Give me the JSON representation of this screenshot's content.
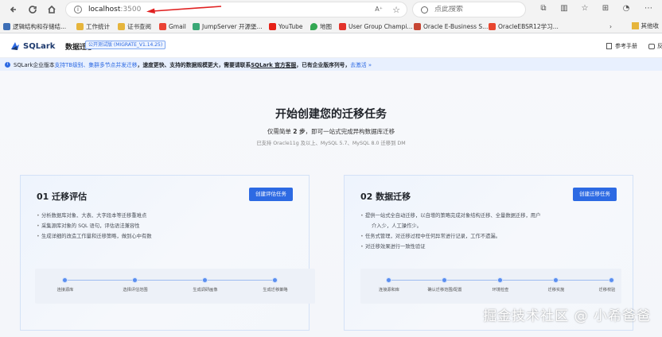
{
  "browser": {
    "url_host": "localhost",
    "url_port": ":3500",
    "search_placeholder": "点此搜索",
    "reader_label": "A⁺",
    "icons": [
      "back-icon",
      "refresh-icon",
      "home-icon",
      "info-icon",
      "star-icon",
      "split-icon",
      "favorites-icon",
      "collections-icon",
      "more-icon"
    ]
  },
  "bookmarks": {
    "items": [
      {
        "label": "逻辑结构和存储结...",
        "color": "#3d6fb6"
      },
      {
        "label": "工作统计",
        "color": "#e6b53c"
      },
      {
        "label": "证书查阅",
        "color": "#e6b53c"
      },
      {
        "label": "Gmail",
        "color": "#ea4335"
      },
      {
        "label": "JumpServer 开源堡...",
        "color": "#3aa876"
      },
      {
        "label": "YouTube",
        "color": "#e62117"
      },
      {
        "label": "地图",
        "color": "#34a853"
      },
      {
        "label": "User Group Champi...",
        "color": "#e3322b"
      },
      {
        "label": "Oracle E-Business S...",
        "color": "#c74634"
      },
      {
        "label": "OracleEBSR12学习...",
        "color": "#e8462f"
      }
    ],
    "more_label": "其他收"
  },
  "app": {
    "logo_text": "SQLark",
    "title": "数据迁移",
    "beta_tag": "公开测试版 (MIGRATE_V1.14.25)",
    "manual": "参考手册",
    "feedback": "反"
  },
  "notice": {
    "prefix": "SQLark企业版本",
    "link1": "支持TB级别、集群多节点并发迁移",
    "mid": "，速度更快、支持的数据规模更大，需要请联系",
    "link2": "SQLark 官方客服",
    "suffix": "，已有企业版序列号，",
    "activate": "去激活 »"
  },
  "hero": {
    "title": "开始创建您的迁移任务",
    "sub_before": "仅需简单",
    "sub_step": "2 步",
    "sub_after": "，即可一站式完成异构数据库迁移",
    "note": "已支持 Oracle11g 及以上、MySQL 5.7、MySQL 8.0 迁移到 DM"
  },
  "cards": [
    {
      "title": "01 迁移评估",
      "button": "创建评估任务",
      "bullets": [
        {
          "text": "分析数据库对象、大表、大字段本等迁移重难点",
          "cont": false
        },
        {
          "text": "采集源库对象的 SQL 语句，评估语法兼容性",
          "cont": false
        },
        {
          "text": "生成详细的改造工作量和迁移策略，做到心中有数",
          "cont": false
        }
      ],
      "steps": [
        "连接源库",
        "选择评估范围",
        "生成调研画像",
        "生成迁移策略"
      ]
    },
    {
      "title": "02 数据迁移",
      "button": "创建迁移任务",
      "bullets": [
        {
          "text": "提供一站式全自动迁移，以自增的策略完成对象结构迁移、全量数据迁移，用户",
          "cont": false
        },
        {
          "text": "介入少，人工操作少。",
          "cont": true
        },
        {
          "text": "任务式管理，对迁移过程中任何异常进行记录，工作不遗漏。",
          "cont": false
        },
        {
          "text": "对迁移效果进行一致性验证",
          "cont": false
        }
      ],
      "steps": [
        "连接源和库",
        "确认迁移范围/配置",
        "环境检查",
        "迁移实施",
        "迁移校验"
      ]
    }
  ],
  "watermark": "掘金技术社区 @ 小希爸爸"
}
